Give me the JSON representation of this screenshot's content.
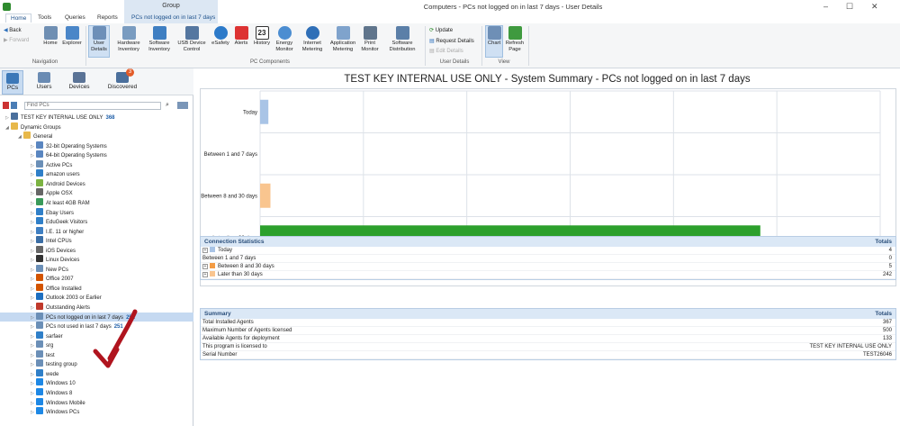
{
  "window": {
    "title": "Computers - PCs not logged on in last 7 days - User Details",
    "context_group": "Group"
  },
  "tabs": [
    {
      "label": "Home"
    },
    {
      "label": "Tools"
    },
    {
      "label": "Queries"
    },
    {
      "label": "Reports"
    },
    {
      "label": "PCs not logged on in last 7 days"
    }
  ],
  "ribbon": {
    "nav": {
      "back": "Back",
      "forward": "Forward",
      "home": "Home",
      "explorer": "Explorer",
      "group": "Navigation"
    },
    "components": [
      {
        "label": "User Details",
        "icon": "user-details-icon"
      },
      {
        "label": "Hardware Inventory",
        "icon": "hardware-icon"
      },
      {
        "label": "Software Inventory",
        "icon": "software-icon"
      },
      {
        "label": "USB Device Control",
        "icon": "usb-icon"
      },
      {
        "label": "eSafety",
        "icon": "esafety-icon"
      },
      {
        "label": "Alerts",
        "icon": "alert-icon"
      },
      {
        "label": "History",
        "icon": "calendar-icon"
      },
      {
        "label": "Energy Monitor",
        "icon": "energy-icon"
      },
      {
        "label": "Internet Metering",
        "icon": "globe-icon"
      },
      {
        "label": "Application Metering",
        "icon": "app-icon"
      },
      {
        "label": "Print Monitor",
        "icon": "printer-icon"
      },
      {
        "label": "Software Distribution",
        "icon": "distribution-icon"
      }
    ],
    "history_day": "23",
    "components_group": "PC Components",
    "user_details": {
      "update": "Update",
      "request": "Request Details",
      "edit": "Edit Details",
      "group": "User Details"
    },
    "view": {
      "chart": "Chart",
      "refresh": "Refresh Page",
      "group": "View"
    }
  },
  "left_nav": {
    "tabs": [
      {
        "label": "PCs"
      },
      {
        "label": "Users"
      },
      {
        "label": "Devices"
      },
      {
        "label": "Discovered",
        "badge": "3"
      }
    ],
    "search_placeholder": "Find PCs",
    "tree": [
      {
        "label": "TEST KEY INTERNAL USE ONLY",
        "count": "368",
        "level": 0,
        "expand": "▷",
        "icon": "computer-icon"
      },
      {
        "label": "Dynamic Groups",
        "level": 0,
        "expand": "◢",
        "icon": "folder-icon"
      },
      {
        "label": "General",
        "level": 1,
        "expand": "◢",
        "icon": "folder-icon"
      },
      {
        "label": "32-bit Operating Systems",
        "level": 2,
        "expand": "▷",
        "icon": "os-icon"
      },
      {
        "label": "64-bit Operating Systems",
        "level": 2,
        "expand": "▷",
        "icon": "os-icon"
      },
      {
        "label": "Active PCs",
        "level": 2,
        "expand": "▷",
        "icon": "pc-icon"
      },
      {
        "label": "amazon users",
        "level": 2,
        "expand": "▷",
        "icon": "globe-icon"
      },
      {
        "label": "Android Devices",
        "level": 2,
        "expand": "▷",
        "icon": "android-icon"
      },
      {
        "label": "Apple OSX",
        "level": 2,
        "expand": "▷",
        "icon": "apple-icon"
      },
      {
        "label": "At least 4GB RAM",
        "level": 2,
        "expand": "▷",
        "icon": "ram-icon"
      },
      {
        "label": "Ebay Users",
        "level": 2,
        "expand": "▷",
        "icon": "globe-icon"
      },
      {
        "label": "EduGeek Visitors",
        "level": 2,
        "expand": "▷",
        "icon": "globe-icon"
      },
      {
        "label": "I.E. 11 or higher",
        "level": 2,
        "expand": "▷",
        "icon": "app-icon"
      },
      {
        "label": "Intel CPUs",
        "level": 2,
        "expand": "▷",
        "icon": "cpu-icon"
      },
      {
        "label": "iOS Devices",
        "level": 2,
        "expand": "▷",
        "icon": "apple-icon"
      },
      {
        "label": "Linux Devices",
        "level": 2,
        "expand": "▷",
        "icon": "linux-icon"
      },
      {
        "label": "New PCs",
        "level": 2,
        "expand": "▷",
        "icon": "pc-icon"
      },
      {
        "label": "Office 2007",
        "level": 2,
        "expand": "▷",
        "icon": "office-icon"
      },
      {
        "label": "Office Installed",
        "level": 2,
        "expand": "▷",
        "icon": "office-icon"
      },
      {
        "label": "Outlook 2003 or Earlier",
        "level": 2,
        "expand": "▷",
        "icon": "outlook-icon"
      },
      {
        "label": "Outstanding Alerts",
        "level": 2,
        "expand": "▷",
        "icon": "alert-icon"
      },
      {
        "label": "PCs not logged on in last 7 days",
        "count": "251",
        "level": 2,
        "expand": "▷",
        "icon": "pc-icon",
        "selected": true
      },
      {
        "label": "PCs not used in last 7 days",
        "count": "251",
        "level": 2,
        "expand": "▷",
        "icon": "pc-icon"
      },
      {
        "label": "sarfaer",
        "level": 2,
        "expand": "▷",
        "icon": "globe-icon"
      },
      {
        "label": "srg",
        "level": 2,
        "expand": "▷",
        "icon": "pc-icon"
      },
      {
        "label": "test",
        "level": 2,
        "expand": "▷",
        "icon": "pc-icon"
      },
      {
        "label": "testing group",
        "level": 2,
        "expand": "▷",
        "icon": "pc-icon"
      },
      {
        "label": "wede",
        "level": 2,
        "expand": "▷",
        "icon": "globe-icon"
      },
      {
        "label": "Windows 10",
        "level": 2,
        "expand": "▷",
        "icon": "windows-icon"
      },
      {
        "label": "Windows 8",
        "level": 2,
        "expand": "▷",
        "icon": "windows-icon"
      },
      {
        "label": "Windows Mobile",
        "level": 2,
        "expand": "▷",
        "icon": "windows-icon"
      },
      {
        "label": "Windows PCs",
        "level": 2,
        "expand": "▷",
        "icon": "windows-icon"
      }
    ]
  },
  "report": {
    "title": "TEST KEY INTERNAL USE ONLY - System Summary - PCs not logged on in last 7 days"
  },
  "chart_data": {
    "type": "bar",
    "orientation": "horizontal",
    "categories": [
      "Today",
      "Between 1 and 7 days",
      "Between 8 and 30 days",
      "Later than 30 days"
    ],
    "values": [
      4,
      0,
      5,
      242
    ],
    "colors": [
      "#a9c4e6",
      "#ffffff",
      "#f9c58f",
      "#2ca02c"
    ],
    "xlim": [
      0,
      300
    ],
    "xticks": [
      0,
      50,
      100,
      150,
      200,
      250,
      300
    ],
    "grid": true,
    "title": "",
    "xlabel": "",
    "ylabel": ""
  },
  "connection_stats": {
    "title": "Connection Statistics",
    "totals_label": "Totals",
    "rows": [
      {
        "label": "Today",
        "value": "4",
        "color": "#a9c4e6",
        "expand": true
      },
      {
        "label": "Between 1 and 7 days",
        "value": "0",
        "color": "",
        "expand": false
      },
      {
        "label": "Between 8 and 30 days",
        "value": "5",
        "color": "#f39c45",
        "expand": true
      },
      {
        "label": "Later than 30 days",
        "value": "242",
        "color": "#f9c58f",
        "expand": true
      }
    ]
  },
  "summary": {
    "title": "Summary",
    "totals_label": "Totals",
    "rows": [
      {
        "label": "Total Installed Agents",
        "value": "367"
      },
      {
        "label": "Maximum Number of Agents licensed",
        "value": "500"
      },
      {
        "label": "Available Agents for deployment",
        "value": "133"
      },
      {
        "label": "This program is licensed to",
        "value": "TEST KEY INTERNAL USE ONLY"
      },
      {
        "label": "Serial Number",
        "value": "TEST26046"
      }
    ]
  }
}
